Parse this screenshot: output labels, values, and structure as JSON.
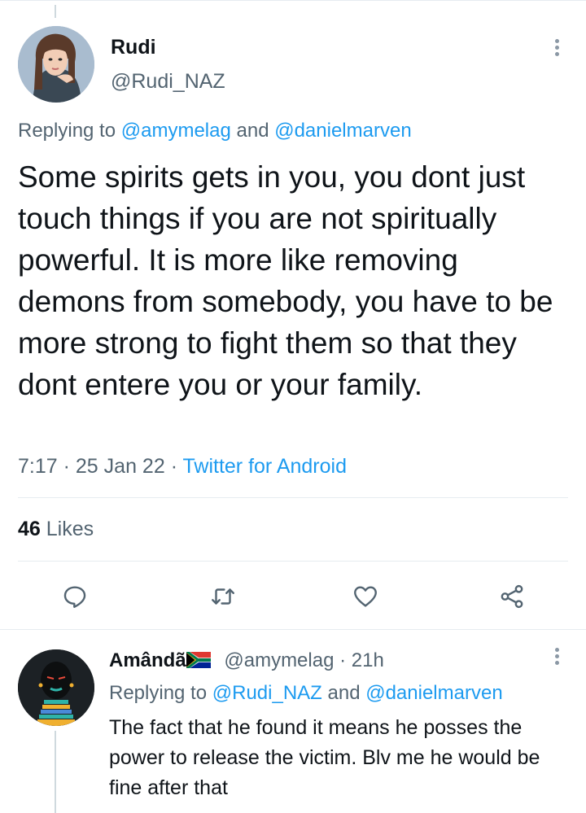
{
  "main_tweet": {
    "author_name": "Rudi",
    "author_handle": "@Rudi_NAZ",
    "avatar": "cartoon-woman-avatar",
    "replying_prefix": "Replying to",
    "replying_to_1": "@amymelag",
    "replying_and": "and",
    "replying_to_2": "@danielmarven",
    "text": "Some spirits gets in you, you dont just touch things if you are not spiritually powerful. It is more like removing demons from somebody, you have to be more strong to fight them so that they dont entere you or your family.",
    "time": "7:17",
    "date": "25 Jan 22",
    "source": "Twitter for Android",
    "likes_count": "46",
    "likes_label": "Likes"
  },
  "actions": {
    "reply_icon": "speech-bubble",
    "retweet_icon": "retweet-arrows",
    "like_icon": "heart",
    "share_icon": "share-nodes"
  },
  "reply_tweet": {
    "author_name": "Amândã",
    "flag": "south-africa-flag",
    "author_handle": "@amymelag",
    "time_ago": "21h",
    "replying_prefix": "Replying to",
    "replying_to_1": "@Rudi_NAZ",
    "replying_and": "and",
    "replying_to_2": "@danielmarven",
    "text": "The fact that he found it means he posses the power to release the victim. Blv me he would be fine after that"
  },
  "colors": {
    "text_primary": "#0f1419",
    "text_secondary": "#536471",
    "link_blue": "#1d9bf0",
    "divider": "#e6ecf0"
  }
}
